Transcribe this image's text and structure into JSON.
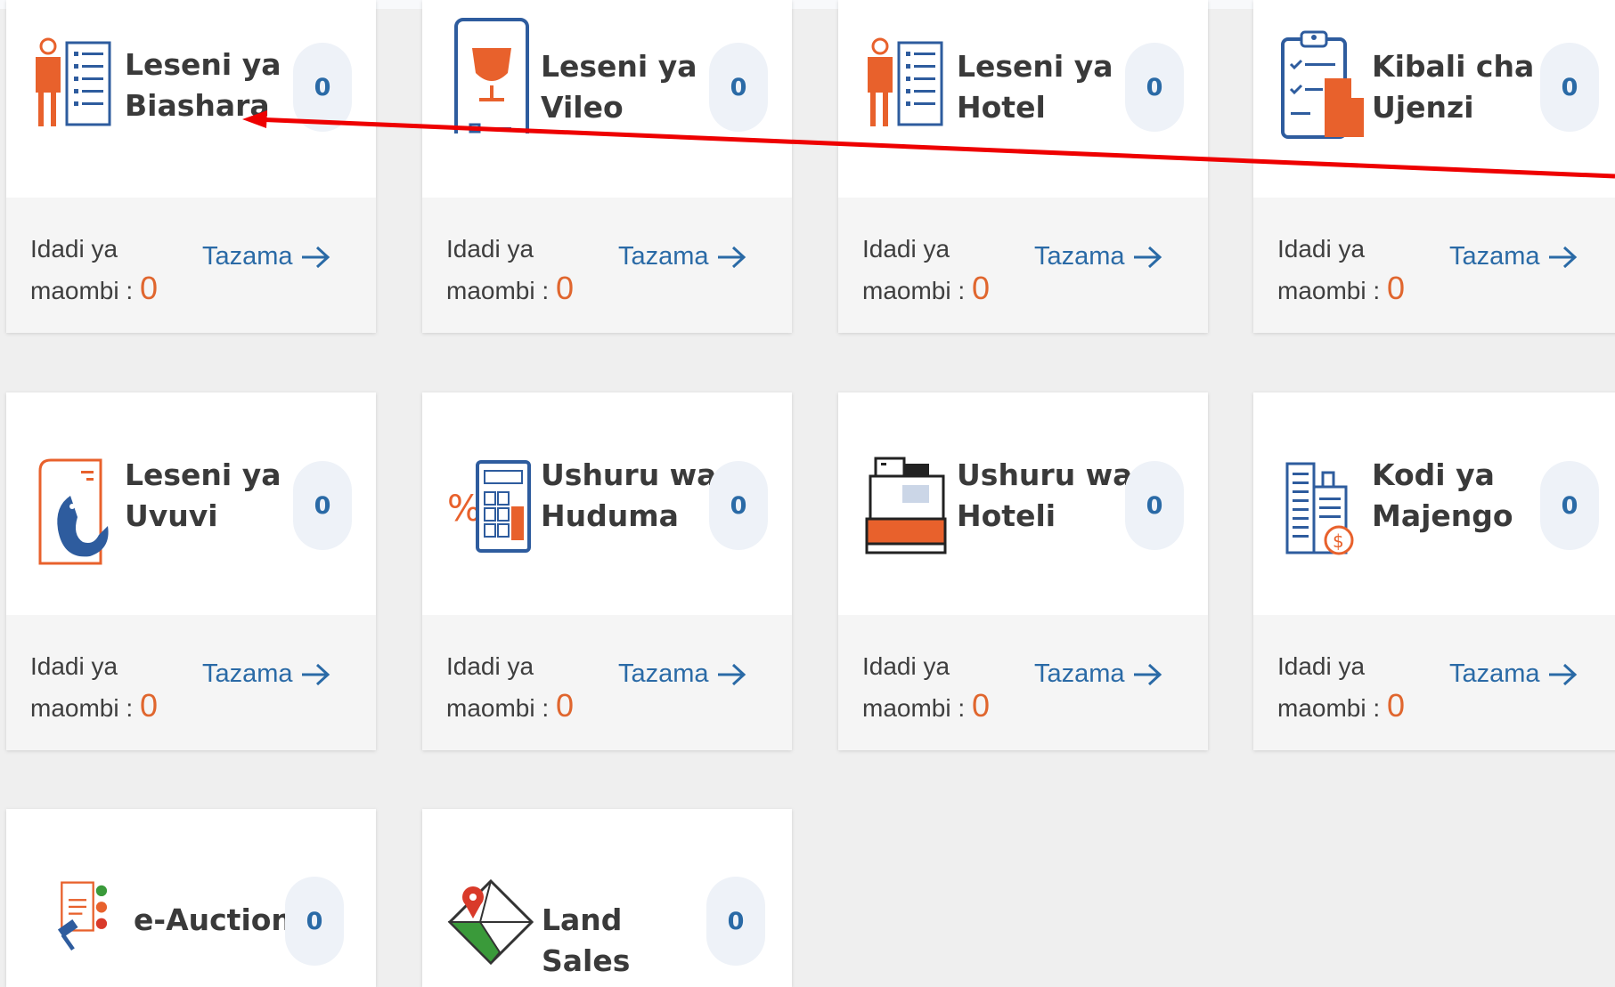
{
  "cards": [
    {
      "title": "Leseni ya Biashara",
      "badge": "0",
      "count_label": "Idadi ya maombi :",
      "count": "0",
      "view_label": "Tazama",
      "icon": "business-license-icon"
    },
    {
      "title": "Leseni ya Vileo",
      "badge": "0",
      "count_label": "Idadi ya maombi :",
      "count": "0",
      "view_label": "Tazama",
      "icon": "liquor-license-icon"
    },
    {
      "title": "Leseni ya Hotel",
      "badge": "0",
      "count_label": "Idadi ya maombi :",
      "count": "0",
      "view_label": "Tazama",
      "icon": "hotel-license-icon"
    },
    {
      "title": "Kibali cha Ujenzi",
      "badge": "0",
      "count_label": "Idadi ya maombi :",
      "count": "0",
      "view_label": "Tazama",
      "icon": "building-permit-icon"
    },
    {
      "title": "Leseni ya Uvuvi",
      "badge": "0",
      "count_label": "Idadi ya maombi :",
      "count": "0",
      "view_label": "Tazama",
      "icon": "fishing-license-icon"
    },
    {
      "title": "Ushuru wa Huduma",
      "badge": "0",
      "count_label": "Idadi ya maombi :",
      "count": "0",
      "view_label": "Tazama",
      "icon": "service-levy-icon"
    },
    {
      "title": "Ushuru wa Hoteli",
      "badge": "0",
      "count_label": "Idadi ya maombi :",
      "count": "0",
      "view_label": "Tazama",
      "icon": "hotel-levy-icon"
    },
    {
      "title": "Kodi ya Majengo",
      "badge": "0",
      "count_label": "Idadi ya maombi :",
      "count": "0",
      "view_label": "Tazama",
      "icon": "property-tax-icon"
    },
    {
      "title": "e-Auction",
      "badge": "0",
      "icon": "e-auction-icon"
    },
    {
      "title": "Land Sales",
      "badge": "0",
      "icon": "land-sales-icon"
    }
  ],
  "colors": {
    "accent_blue": "#2a6aa6",
    "count_orange": "#e0662e",
    "icon_orange": "#e8612c",
    "annotation_red": "#ee0000"
  }
}
